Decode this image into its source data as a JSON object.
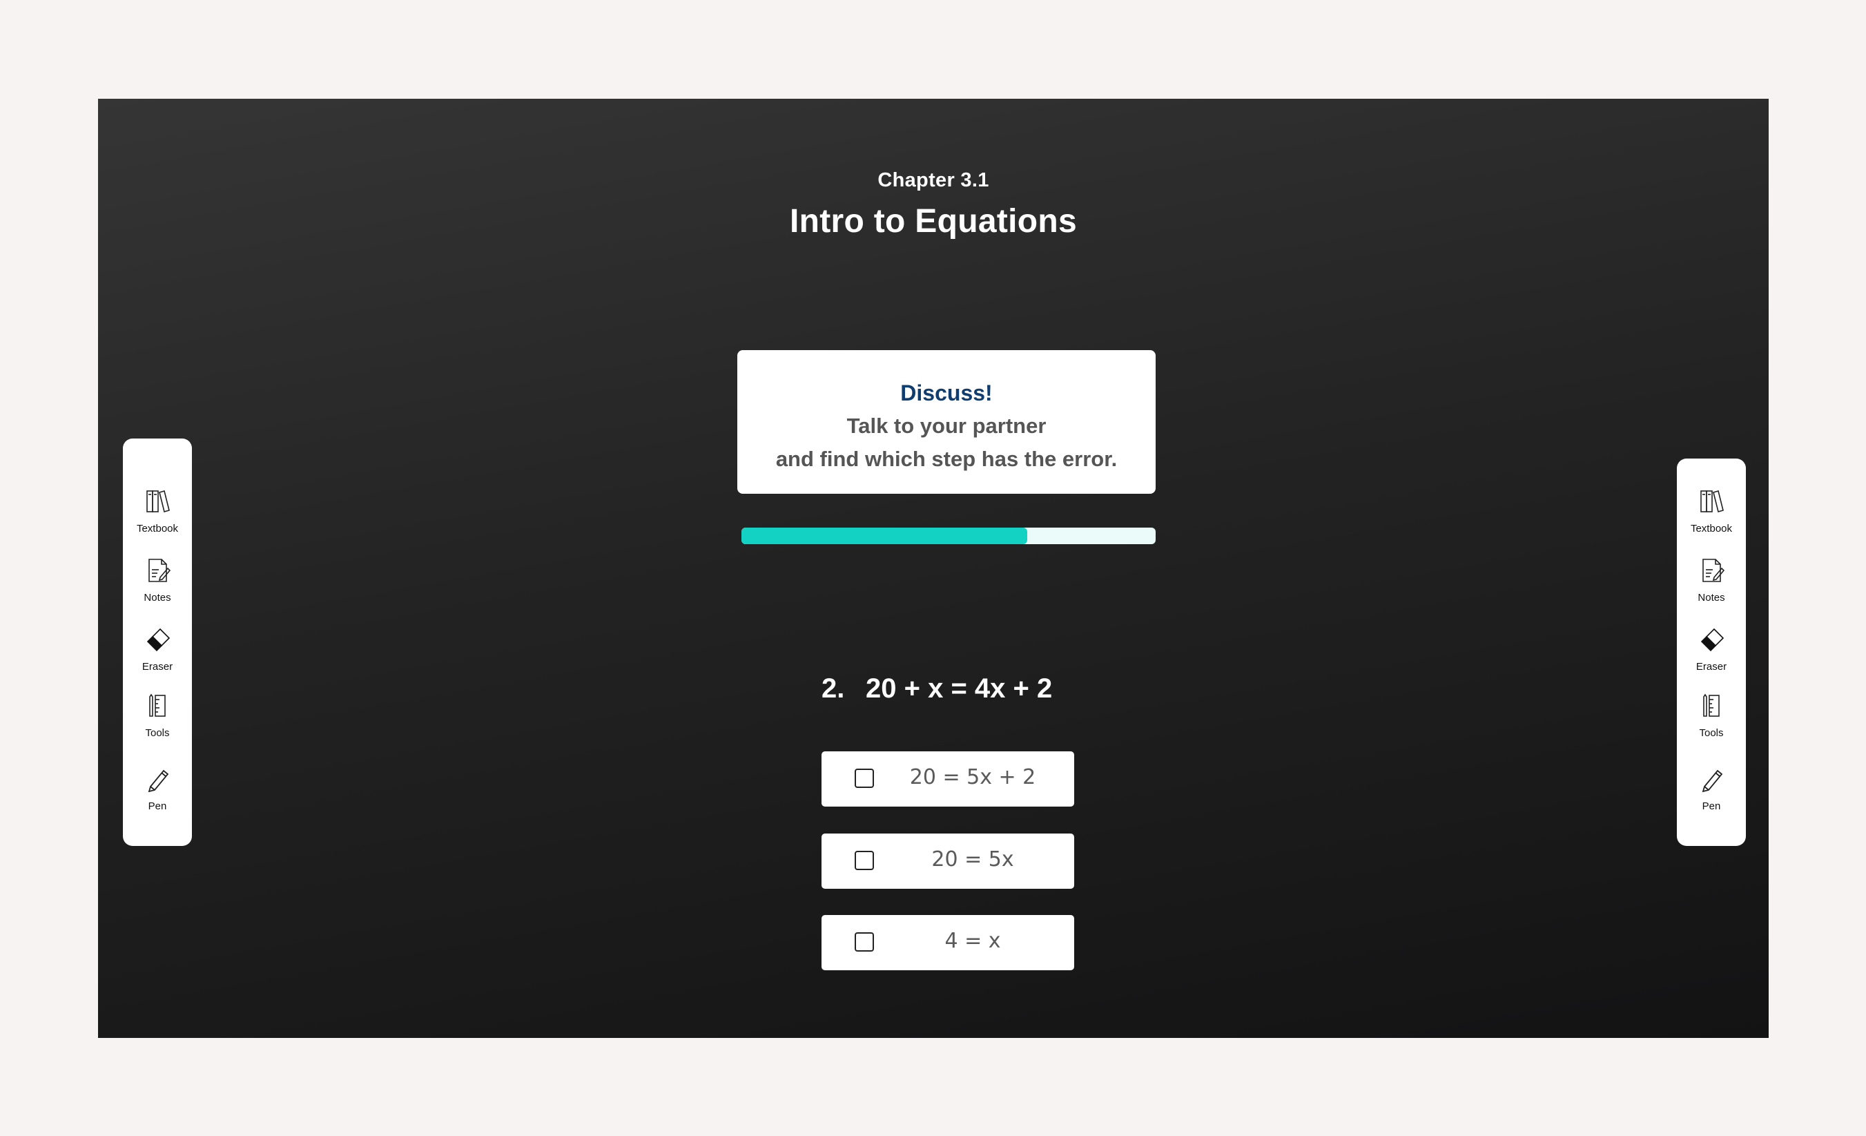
{
  "chapter": {
    "label": "Chapter 3.1",
    "title": "Intro to Equations"
  },
  "discuss": {
    "heading": "Discuss!",
    "line1": "Talk to your partner",
    "line2": "and find which step has the error."
  },
  "progress": {
    "fraction": 0.69
  },
  "question": {
    "number": "2.",
    "equation": "20 + x = 4x + 2",
    "options": [
      {
        "text": "20 = 5x + 2",
        "checked": false
      },
      {
        "text": "20 = 5x",
        "checked": false
      },
      {
        "text": "4 = x",
        "checked": false
      }
    ]
  },
  "toolbar_left": {
    "tools": [
      {
        "label": "Textbook",
        "icon": "textbook-icon"
      },
      {
        "label": "Notes",
        "icon": "notes-icon"
      },
      {
        "label": "Eraser",
        "icon": "eraser-icon"
      },
      {
        "label": "Tools",
        "icon": "tools-icon"
      },
      {
        "label": "Pen",
        "icon": "pen-icon"
      }
    ]
  },
  "toolbar_right": {
    "tools": [
      {
        "label": "Textbook",
        "icon": "textbook-icon"
      },
      {
        "label": "Notes",
        "icon": "notes-icon"
      },
      {
        "label": "Eraser",
        "icon": "eraser-icon"
      },
      {
        "label": "Tools",
        "icon": "tools-icon"
      },
      {
        "label": "Pen",
        "icon": "pen-icon"
      }
    ]
  },
  "colors": {
    "accent": "#13d2c4",
    "progress_track": "#eafbfa",
    "discuss_heading": "#0f3d70",
    "board_dark": "#1b1b1c"
  }
}
